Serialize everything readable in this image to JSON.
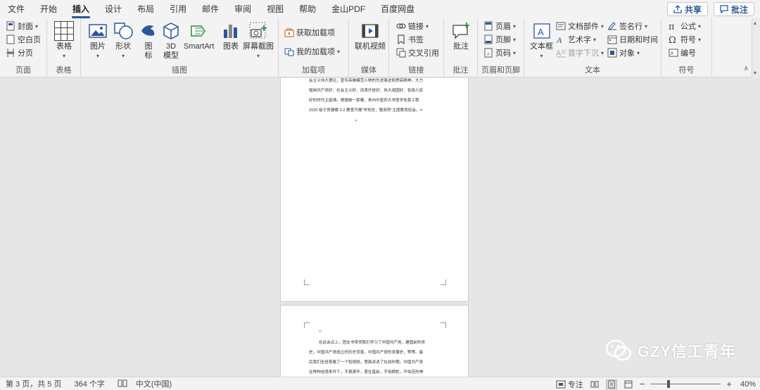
{
  "menu": {
    "tabs": [
      "文件",
      "开始",
      "插入",
      "设计",
      "布局",
      "引用",
      "邮件",
      "审阅",
      "视图",
      "帮助",
      "金山PDF",
      "百度网盘"
    ],
    "active_tab": "插入",
    "share_label": "共享",
    "comment_label": "批注"
  },
  "ribbon": {
    "pages": {
      "label": "页面",
      "cover": "封面",
      "blank_page": "空白页",
      "page_break": "分页"
    },
    "tables": {
      "label": "表格",
      "table": "表格"
    },
    "illustrations": {
      "label": "插图",
      "picture": "图片",
      "shapes": "形状",
      "icons_1": "图",
      "icons_2": "标",
      "model_1": "3D",
      "model_2": "模型",
      "smartart": "SmartArt",
      "chart": "图表",
      "screenshot": "屏幕截图"
    },
    "addins": {
      "label": "加载项",
      "get_addins": "获取加载项",
      "my_addins": "我的加载项"
    },
    "media": {
      "label": "媒体",
      "online_video": "联机视频"
    },
    "links": {
      "label": "链接",
      "link": "链接",
      "bookmark": "书签",
      "cross_reference": "交叉引用"
    },
    "comments": {
      "label": "批注",
      "comment": "批注"
    },
    "header_footer": {
      "label": "页眉和页脚",
      "header": "页眉",
      "footer": "页脚",
      "page_number": "页码"
    },
    "text": {
      "label": "文本",
      "text_box": "文本框",
      "quick_parts": "文档部件",
      "wordart": "艺术字",
      "drop_cap": "首字下沉",
      "signature_line": "签名行",
      "date_time": "日期和时间",
      "object": "对象"
    },
    "symbols": {
      "label": "符号",
      "equation": "公式",
      "symbol": "符号",
      "number": "编号"
    }
  },
  "document": {
    "page1_lines": [
      "会主义伟大理论，宣传英雄模范人物的先进事迹和崇高精神，大力",
      "唱响共产党好、社会主义好、改革开放好、伟大祖国好、各族人民",
      "好的时代主旋律。根据统一部署，贵州中医药大学医学信息工程",
      "2020 级于房建楼 3-2 教室开展“学党史，敬英烈”主题教育班会。↵"
    ],
    "page1_mark": "↵",
    "page2_mark": "↵",
    "page2_lines": [
      "在此会议上，团支书带领我们学习了中国共产党。建国前的党",
      "史，中国共产党成立的历史背景，中国共产党的发展史，等等。最",
      "后我们全班观看了一个短视频，里面讲述了抗战时期，中国共产党",
      "在种种逆境条件下，不畏艰辛，勇往直前，不怕牺牲，不怕苦的神"
    ]
  },
  "watermark": {
    "text": "GZY信工青年"
  },
  "status": {
    "page_info": "第 3 页，共 5 页",
    "word_count": "364 个字",
    "language": "中文(中国)",
    "focus": "专注",
    "zoom": "40%",
    "zoom_fraction": 0.26
  }
}
